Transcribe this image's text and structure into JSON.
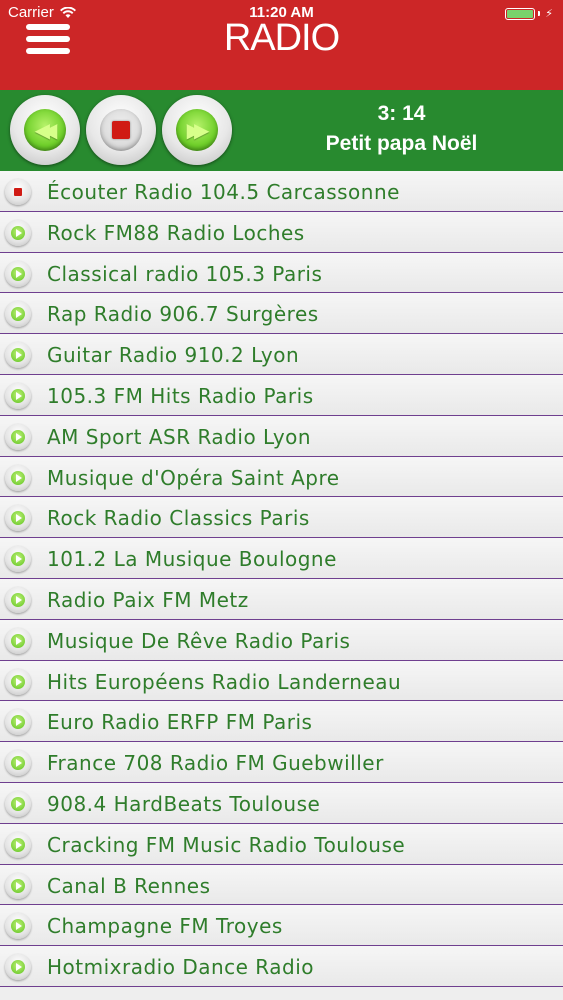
{
  "status_bar": {
    "carrier": "Carrier",
    "time": "11:20 AM",
    "battery_level": 1.0,
    "charging": true
  },
  "header": {
    "title": "RADIO",
    "background": "#cc2627"
  },
  "player": {
    "background": "#288a2f",
    "time": "3: 14",
    "song": "Petit papa Noël",
    "buttons": [
      "rewind",
      "stop",
      "fast-forward"
    ]
  },
  "stations": [
    {
      "label": "Écouter Radio 104.5 Carcassonne",
      "playing": true
    },
    {
      "label": "Rock FM88 Radio Loches",
      "playing": false
    },
    {
      "label": "Classical radio 105.3 Paris",
      "playing": false
    },
    {
      "label": "Rap Radio 906.7 Surgères",
      "playing": false
    },
    {
      "label": "Guitar Radio 910.2 Lyon",
      "playing": false
    },
    {
      "label": "105.3 FM Hits Radio Paris",
      "playing": false
    },
    {
      "label": "AM Sport ASR Radio Lyon",
      "playing": false
    },
    {
      "label": "Musique d'Opéra Saint Apre",
      "playing": false
    },
    {
      "label": "Rock Radio Classics Paris",
      "playing": false
    },
    {
      "label": "101.2 La Musique Boulogne",
      "playing": false
    },
    {
      "label": "Radio Paix FM Metz",
      "playing": false
    },
    {
      "label": "Musique De Rêve Radio Paris",
      "playing": false
    },
    {
      "label": "Hits Européens Radio Landerneau",
      "playing": false
    },
    {
      "label": "Euro Radio ERFP FM Paris",
      "playing": false
    },
    {
      "label": "France 708 Radio FM Guebwiller",
      "playing": false
    },
    {
      "label": "908.4 HardBeats Toulouse",
      "playing": false
    },
    {
      "label": "Cracking FM Music Radio Toulouse",
      "playing": false
    },
    {
      "label": "Canal B Rennes",
      "playing": false
    },
    {
      "label": "Champagne FM Troyes",
      "playing": false
    },
    {
      "label": "Hotmixradio Dance Radio",
      "playing": false
    }
  ]
}
